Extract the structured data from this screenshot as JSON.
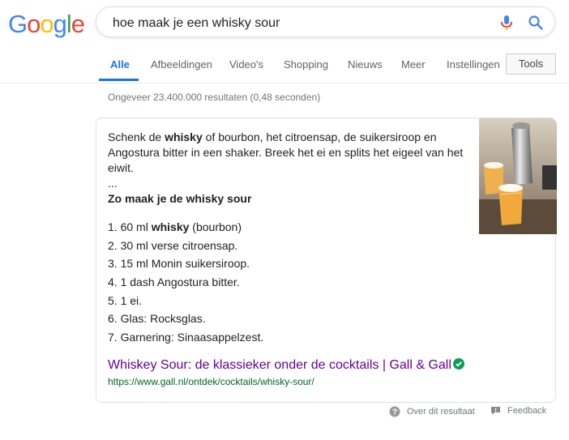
{
  "logo": {
    "letters": [
      "G",
      "o",
      "o",
      "g",
      "l",
      "e"
    ],
    "colors": [
      "#4285F4",
      "#EA4335",
      "#FBBC05",
      "#4285F4",
      "#34A853",
      "#EA4335"
    ]
  },
  "search": {
    "value": "hoe maak je een whisky sour",
    "mic_icon": "microphone-icon",
    "search_icon": "search-icon"
  },
  "tabs": [
    "Alle",
    "Afbeeldingen",
    "Video's",
    "Shopping",
    "Nieuws",
    "Meer",
    "Instellingen"
  ],
  "tools_label": "Tools",
  "result_stats": "Ongeveer 23.400.000 resultaten (0,48 seconden)",
  "snippet": {
    "p1": "Schenk de ",
    "p1_bold": "whisky",
    "p1_rest": " of bourbon, het citroensap, de suikersiroop en Angostura bitter in een shaker. Breek het ei en splits het eigeel van het eiwit.",
    "ellipsis": "...",
    "heading": "Zo maak je de whisky sour",
    "steps": [
      {
        "pre": "1. 60 ml ",
        "bold": "whisky",
        "post": " (bourbon)"
      },
      {
        "pre": "2. 30 ml verse citroensap.",
        "bold": "",
        "post": ""
      },
      {
        "pre": "3. 15 ml Monin suikersiroop.",
        "bold": "",
        "post": ""
      },
      {
        "pre": "4. 1 dash Angostura bitter.",
        "bold": "",
        "post": ""
      },
      {
        "pre": "5. 1 ei.",
        "bold": "",
        "post": ""
      },
      {
        "pre": "6. Glas: Rocksglas.",
        "bold": "",
        "post": ""
      },
      {
        "pre": "7. Garnering: Sinaasappelzest.",
        "bold": "",
        "post": ""
      }
    ]
  },
  "result": {
    "title": "Whiskey Sour: de klassieker onder de cocktails | Gall & Gall",
    "url": "https://www.gall.nl/ontdek/cocktails/whisky-sour/",
    "verified_icon": "verified-check-icon"
  },
  "footer": {
    "about": "Over dit resultaat",
    "feedback": "Feedback"
  },
  "colors": {
    "accent": "#1a73e8",
    "visited_link": "#660099",
    "url_green": "#006621",
    "verified": "#0f9d58"
  }
}
